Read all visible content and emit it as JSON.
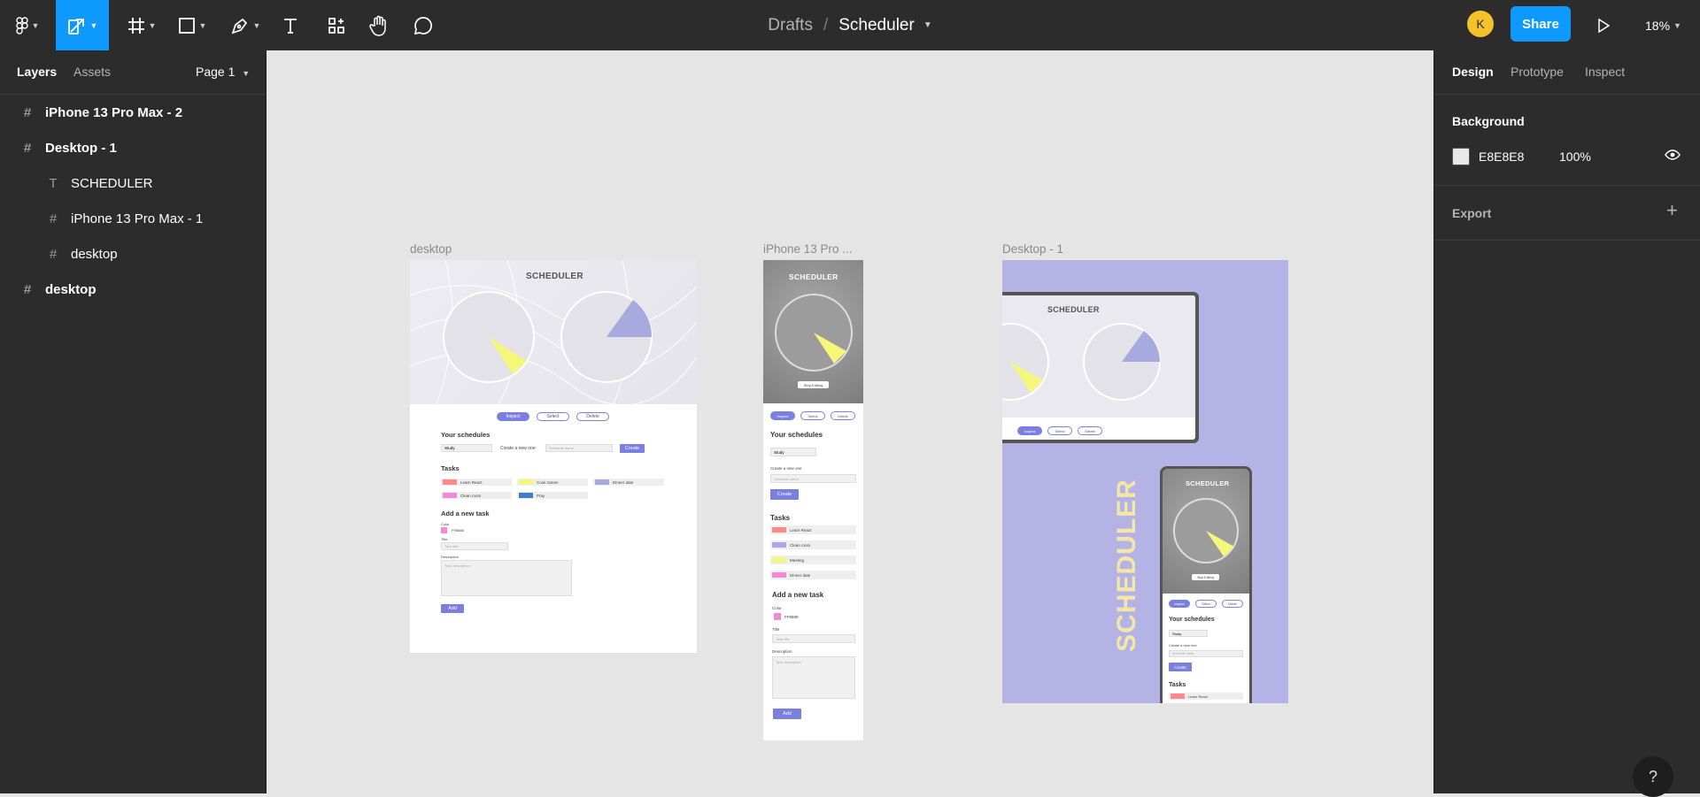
{
  "topbar": {
    "breadcrumb_parent": "Drafts",
    "breadcrumb_sep": "/",
    "file_name": "Scheduler",
    "avatar_initial": "K",
    "share_label": "Share",
    "zoom": "18%"
  },
  "left_panel": {
    "tabs": [
      "Layers",
      "Assets"
    ],
    "page_selector": "Page 1",
    "layers": [
      {
        "name": "iPhone 13 Pro Max - 2",
        "type": "frame",
        "indent": 0
      },
      {
        "name": "Desktop - 1",
        "type": "frame",
        "indent": 0
      },
      {
        "name": "SCHEDULER",
        "type": "text",
        "indent": 1
      },
      {
        "name": "iPhone 13 Pro Max - 1",
        "type": "frame",
        "indent": 1
      },
      {
        "name": "desktop",
        "type": "frame",
        "indent": 1
      },
      {
        "name": "desktop",
        "type": "frame",
        "indent": 0
      }
    ]
  },
  "right_panel": {
    "tabs": [
      "Design",
      "Prototype",
      "Inspect"
    ],
    "background_label": "Background",
    "background_color": "E8E8E8",
    "background_opacity": "100%",
    "export_label": "Export"
  },
  "canvas": {
    "frame_labels": [
      "desktop",
      "iPhone 13 Pro ...",
      "Desktop - 1"
    ],
    "mockup": {
      "title": "SCHEDULER",
      "pills": [
        "Inspect",
        "Select",
        "Delete"
      ],
      "your_schedules": "Your schedules",
      "select_value": "Study",
      "create_new": "Create a new one:",
      "create_new_mobile": "Create a new one",
      "schedule_placeholder": "Schedule name",
      "create_btn": "Create",
      "tasks_heading": "Tasks",
      "tasks_desktop": [
        "Learn React",
        "Cook ramen",
        "Dinner date",
        "Clean room",
        "Pray"
      ],
      "tasks_mobile": [
        "Learn React",
        "Clean room",
        "Meeting",
        "Dinner date"
      ],
      "add_task_heading": "Add a new task",
      "color_label": "Color",
      "color_value": "FF8888",
      "title_label": "Title",
      "title_placeholder": "Task title",
      "desc_label": "Description",
      "desc_placeholder": "Task description",
      "add_btn": "Add",
      "stop_label": "Stop Editing",
      "promo_word": "SCHEDULER"
    },
    "colors": {
      "accent": "#7a7fe0",
      "promo_bg": "#b3b3e6",
      "promo_text": "#f5e6a8",
      "slice_yellow": "#f5f77a",
      "slice_purple": "#a6aade"
    }
  }
}
